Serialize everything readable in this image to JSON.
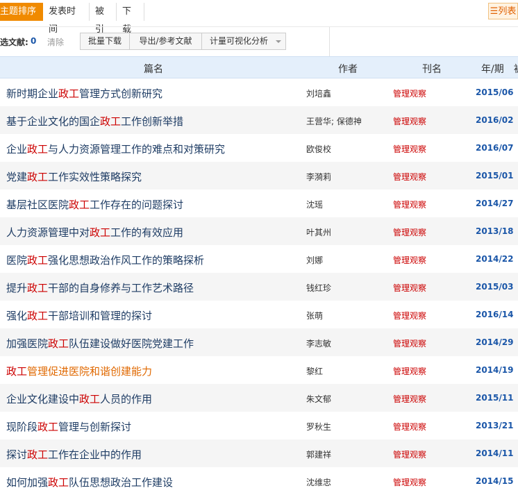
{
  "sort": {
    "tabs": [
      {
        "label": "主题排序",
        "arrow": "↓",
        "active": true
      },
      {
        "label": "发表时间"
      },
      {
        "label": "被引"
      },
      {
        "label": "下载"
      }
    ],
    "view_button": "☰列表"
  },
  "actions": {
    "selected_label": "选文献:",
    "selected_count": "0",
    "clear": "清除",
    "batch_download": "批量下载",
    "export": "导出/参考文献",
    "analysis": "计量可视化分析"
  },
  "table": {
    "headers": {
      "title": "篇名",
      "author": "作者",
      "journal": "刊名",
      "issue": "年/期",
      "extra": "被"
    },
    "highlight": "政工",
    "rows": [
      {
        "pre": "新时期企业",
        "post": "管理方式创新研究",
        "author": "刘培鑫",
        "journal": "管理观察",
        "issue": "2015/06"
      },
      {
        "pre": "基于企业文化的国企",
        "post": "工作创新举措",
        "author": "王营华; 保德神",
        "journal": "管理观察",
        "issue": "2016/02"
      },
      {
        "pre": "企业",
        "post": "与人力资源管理工作的难点和对策研究",
        "author": "欧俊校",
        "journal": "管理观察",
        "issue": "2016/07"
      },
      {
        "pre": "党建",
        "post": "工作实效性策略探究",
        "author": "李漪莉",
        "journal": "管理观察",
        "issue": "2015/01"
      },
      {
        "pre": "基层社区医院",
        "post": "工作存在的问题探讨",
        "author": "沈瑶",
        "journal": "管理观察",
        "issue": "2014/27"
      },
      {
        "pre": "人力资源管理中对",
        "post": "工作的有效应用",
        "author": "叶其州",
        "journal": "管理观察",
        "issue": "2013/18"
      },
      {
        "pre": "医院",
        "post": "强化思想政治作风工作的策略探析",
        "author": "刘娜",
        "journal": "管理观察",
        "issue": "2014/22"
      },
      {
        "pre": "提升",
        "post": "干部的自身修养与工作艺术路径",
        "author": "钱红珍",
        "journal": "管理观察",
        "issue": "2015/03"
      },
      {
        "pre": "强化",
        "post": "干部培训和管理的探讨",
        "author": "张萌",
        "journal": "管理观察",
        "issue": "2016/14"
      },
      {
        "pre": "加强医院",
        "post": "队伍建设做好医院党建工作",
        "author": "李志敏",
        "journal": "管理观察",
        "issue": "2014/29"
      },
      {
        "pre": "",
        "post": "管理促进医院和谐创建能力",
        "author": "黎红",
        "journal": "管理观察",
        "issue": "2014/19",
        "visited": true
      },
      {
        "pre": "企业文化建设中",
        "post": "人员的作用",
        "author": "朱文郁",
        "journal": "管理观察",
        "issue": "2015/11"
      },
      {
        "pre": "现阶段",
        "post": "管理与创新探讨",
        "author": "罗秋生",
        "journal": "管理观察",
        "issue": "2013/21"
      },
      {
        "pre": "探讨",
        "post": "工作在企业中的作用",
        "author": "郭建祥",
        "journal": "管理观察",
        "issue": "2014/11"
      },
      {
        "pre": "如何加强",
        "post": "队伍思想政治工作建设",
        "author": "沈维忠",
        "journal": "管理观察",
        "issue": "2014/15"
      }
    ]
  }
}
